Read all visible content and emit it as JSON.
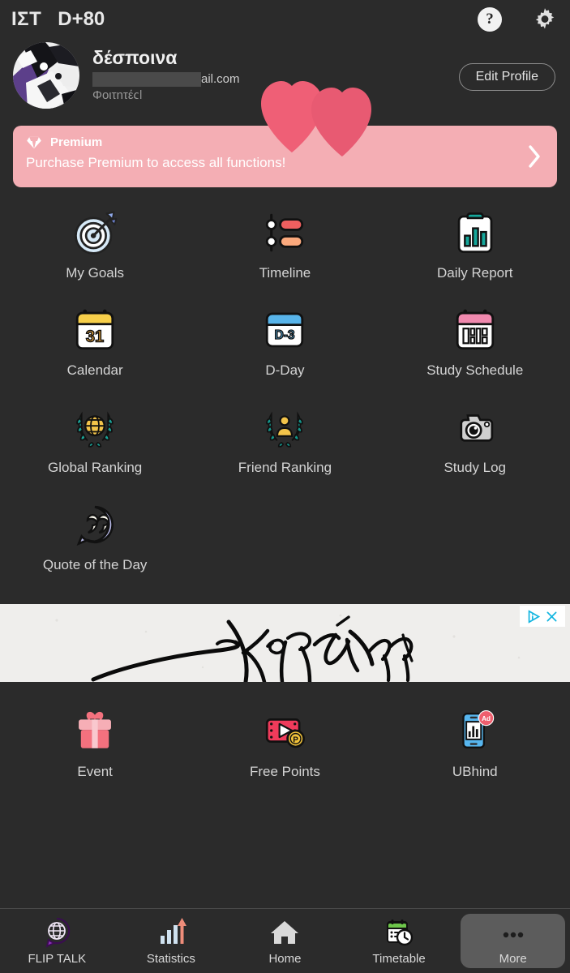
{
  "header": {
    "app_title": "ΙΣΤ",
    "dday": "D+80",
    "help_icon": "help-circle-icon",
    "help_glyph": "?",
    "settings_icon": "gear-icon"
  },
  "profile": {
    "avatar_icon": "user-avatar-image",
    "name": "δέσποινα",
    "email_visible": "ail.com",
    "email_redacted": true,
    "tag": "Φοιτητές|",
    "edit_button": "Edit Profile",
    "decoration_icon": "hearts-sticker"
  },
  "premium": {
    "gem_icon": "diamond-icon",
    "label": "Premium",
    "message": "Purchase Premium to access all functions!",
    "chevron_icon": "chevron-right-icon",
    "bg_color": "#f4aeb4"
  },
  "menu": {
    "items": [
      {
        "label": "My Goals",
        "icon": "target-dartboard-icon"
      },
      {
        "label": "Timeline",
        "icon": "timeline-icon"
      },
      {
        "label": "Daily Report",
        "icon": "clipboard-chart-icon"
      },
      {
        "label": "Calendar",
        "icon": "calendar-31-icon"
      },
      {
        "label": "D-Day",
        "icon": "dday-countdown-icon"
      },
      {
        "label": "Study Schedule",
        "icon": "study-schedule-icon"
      },
      {
        "label": "Global Ranking",
        "icon": "globe-laurel-icon"
      },
      {
        "label": "Friend Ranking",
        "icon": "person-laurel-icon"
      },
      {
        "label": "Study Log",
        "icon": "camera-icon"
      },
      {
        "label": "Quote of the Day",
        "icon": "quote-bubble-icon"
      }
    ]
  },
  "ad": {
    "content_description": "handwritten-signature",
    "adchoices_icon": "adchoices-icon",
    "close_icon": "close-x-icon"
  },
  "promo": {
    "items": [
      {
        "label": "Event",
        "icon": "gift-box-icon"
      },
      {
        "label": "Free Points",
        "icon": "video-coin-icon"
      },
      {
        "label": "UBhind",
        "icon": "phone-chart-icon",
        "badge": "Ad"
      }
    ]
  },
  "navbar": {
    "items": [
      {
        "label": "FLIP TALK",
        "icon": "flip-talk-globe-icon",
        "active": false
      },
      {
        "label": "Statistics",
        "icon": "bar-chart-arrow-icon",
        "active": false
      },
      {
        "label": "Home",
        "icon": "home-icon",
        "active": false
      },
      {
        "label": "Timetable",
        "icon": "timetable-clock-icon",
        "active": false
      },
      {
        "label": "More",
        "icon": "ellipsis-icon",
        "active": true
      }
    ]
  },
  "colors": {
    "background": "#2b2b2b",
    "premium": "#f4aeb4",
    "heart": "#ef5f76",
    "text": "#d4d4d4"
  }
}
